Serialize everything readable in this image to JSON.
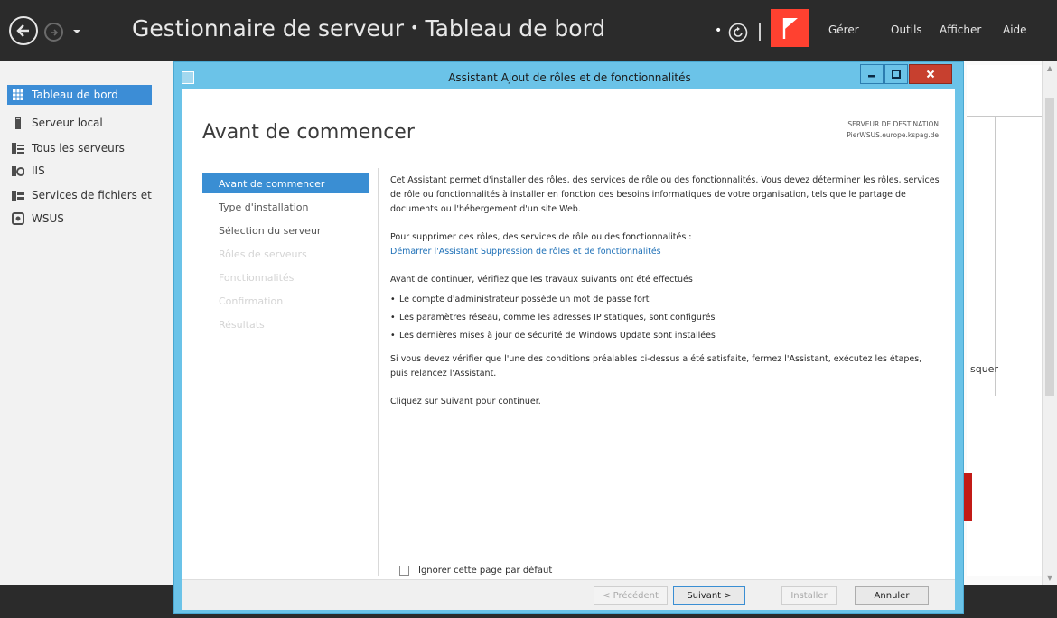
{
  "header": {
    "title": "Gestionnaire de serveur",
    "separator": "•",
    "page": "Tableau de bord",
    "dot": "•",
    "menu": [
      "Gérer",
      "Outils",
      "Afficher",
      "Aide"
    ]
  },
  "sidebar": {
    "items": [
      {
        "label": "Tableau de bord",
        "icon": "dashboard-icon",
        "selected": true
      },
      {
        "label": "Serveur local",
        "icon": "server-icon"
      },
      {
        "label": "Tous les serveurs",
        "icon": "servers-icon"
      },
      {
        "label": "IIS",
        "icon": "iis-icon"
      },
      {
        "label": "Services de fichiers et",
        "icon": "file-services-icon"
      },
      {
        "label": "WSUS",
        "icon": "wsus-icon"
      }
    ]
  },
  "background": {
    "masquer_text": "squer"
  },
  "wizard": {
    "window_title": "Assistant Ajout de rôles et de fonctionnalités",
    "heading": "Avant de commencer",
    "destination_label": "SERVEUR DE DESTINATION",
    "destination_server": "PierWSUS.europe.kspag.de",
    "steps": [
      {
        "label": "Avant de commencer",
        "state": "active"
      },
      {
        "label": "Type d'installation",
        "state": "normal"
      },
      {
        "label": "Sélection du serveur",
        "state": "normal"
      },
      {
        "label": "Rôles de serveurs",
        "state": "disabled"
      },
      {
        "label": "Fonctionnalités",
        "state": "disabled"
      },
      {
        "label": "Confirmation",
        "state": "disabled"
      },
      {
        "label": "Résultats",
        "state": "disabled"
      }
    ],
    "content": {
      "intro": "Cet Assistant permet d'installer des rôles, des services de rôle ou des fonctionnalités. Vous devez déterminer les rôles, services de rôle ou fonctionnalités à installer en fonction des besoins informatiques de votre organisation, tels que le partage de documents ou l'hébergement d'un site Web.",
      "remove_intro": "Pour supprimer des rôles, des services de rôle ou des fonctionnalités :",
      "remove_link": "Démarrer l'Assistant Suppression de rôles et de fonctionnalités",
      "check_intro": "Avant de continuer, vérifiez que les travaux suivants ont été effectués :",
      "checks": [
        "Le compte d'administrateur possède un mot de passe fort",
        "Les paramètres réseau, comme les adresses IP statiques, sont configurés",
        "Les dernières mises à jour de sécurité de Windows Update sont installées"
      ],
      "verify_text": "Si vous devez vérifier que l'une des conditions préalables ci-dessus a été satisfaite, fermez l'Assistant, exécutez les étapes, puis relancez l'Assistant.",
      "continue_text": "Cliquez sur Suivant pour continuer."
    },
    "skip_label": "Ignorer cette page par défaut",
    "buttons": {
      "previous": "< Précédent",
      "next": "Suivant >",
      "install": "Installer",
      "cancel": "Annuler"
    }
  },
  "colors": {
    "header_bg": "#2b2b2b",
    "accent": "#3a8ed3",
    "wizard_frame": "#6bc3e8",
    "flag_red": "#ff4130",
    "close_red": "#c7402f",
    "link": "#1e70b7"
  }
}
